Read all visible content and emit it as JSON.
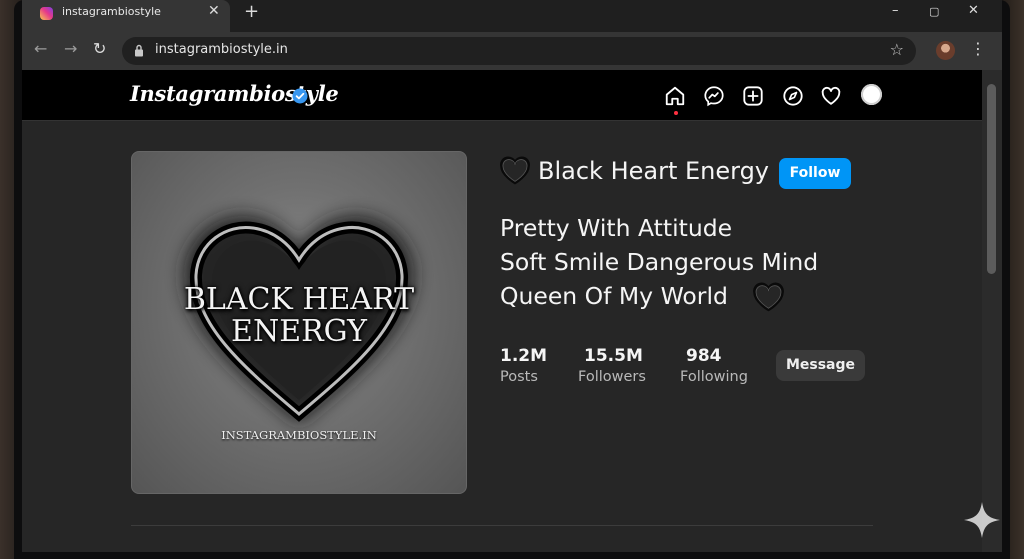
{
  "browser": {
    "tab_title": "instagrambiostyle",
    "tab_close": "✕",
    "new_tab": "+",
    "window_controls": {
      "minimize": "–",
      "maximize": "▢",
      "close": "✕"
    },
    "nav": {
      "back": "←",
      "forward": "→",
      "reload": "↻"
    },
    "url": "instagrambiostyle.in",
    "bookmark_star": "☆",
    "menu": "⋮"
  },
  "instagram": {
    "logo_text": "Instagrambiostyle",
    "nav_icons": [
      "home-icon",
      "messenger-icon",
      "new-post-icon",
      "explore-icon",
      "activity-heart-icon",
      "profile-avatar"
    ],
    "colors": {
      "accent": "#0095f6",
      "verified": "#3897f0",
      "notification_dot": "#ff3040"
    }
  },
  "profile": {
    "picture": {
      "title_line1": "BLACK HEART",
      "title_line2": "ENERGY",
      "site": "INSTAGRAMBIOSTYLE.IN"
    },
    "username": "Black Heart Energy",
    "follow_label": "Follow",
    "bio": [
      "Pretty With Attitude",
      "Soft Smile Dangerous Mind",
      "Queen Of My World"
    ],
    "stats": [
      {
        "value": "1.2M",
        "label": "Posts"
      },
      {
        "value": "15.5M",
        "label": "Followers"
      },
      {
        "value": "984",
        "label": "Following"
      }
    ],
    "message_label": "Message"
  }
}
